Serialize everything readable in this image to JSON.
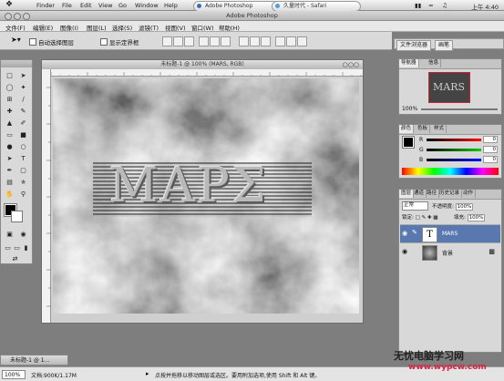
{
  "mac_menubar": {
    "apple": "",
    "items": [
      "Finder",
      "File",
      "Edit",
      "View",
      "Go",
      "Window",
      "Help"
    ],
    "tab1": "Adobe Photoshop",
    "tab2": "久量时代 - Safari",
    "clock": "上午 4:40"
  },
  "app_title": "Adobe Photoshop",
  "ps_menu": [
    "文件(F)",
    "编辑(E)",
    "图像(I)",
    "图层(L)",
    "选择(S)",
    "滤镜(T)",
    "视图(V)",
    "窗口(W)",
    "帮助(H)"
  ],
  "options": {
    "auto_select": "自动选择图层",
    "show_bounds": "显示定界框"
  },
  "file_browser_tab": "文件浏览器",
  "brush_tab": "画笔",
  "document": {
    "title": "未标题-1 @ 100% (MARS, RGB)",
    "text": "ΜΑΡΣ"
  },
  "navigator": {
    "tab_nav": "导航器",
    "tab_info": "信息",
    "zoom": "100%",
    "thumb_text": "MARS"
  },
  "color_panel": {
    "tab_color": "颜色",
    "tab_swatch": "色板",
    "tab_style": "样式",
    "r_label": "R",
    "g_label": "G",
    "b_label": "B",
    "r": "0",
    "g": "0",
    "b": "0",
    "colors": {
      "r": "#d22",
      "g": "#2a2",
      "b": "#23c"
    }
  },
  "layers_panel": {
    "tabs": [
      "图层",
      "通道",
      "路径",
      "历史记录",
      "动作"
    ],
    "blend": "正常",
    "opacity_label": "不透明度:",
    "opacity": "100%",
    "lock_label": "锁定:",
    "fill_label": "填充:",
    "fill": "100%",
    "layers": [
      {
        "name": "MARS",
        "thumb": "T"
      },
      {
        "name": "背景",
        "thumb": ""
      }
    ]
  },
  "status": {
    "zoom": "100%",
    "docinfo": "文档:900K/1.17M",
    "hint": "点按并拖移以移动图层或选区。要用附加选项,使用 Shift 和 Alt 键。",
    "mini_doc": "未标题-1 @ 1..."
  },
  "watermark": {
    "line1": "无忧电脑学习网",
    "line2": "www.wypcw.com"
  }
}
